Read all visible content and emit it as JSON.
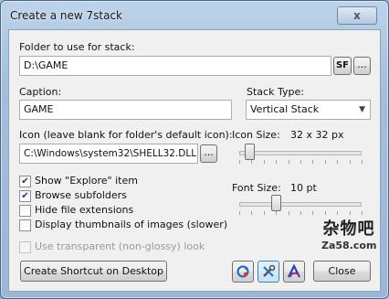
{
  "window": {
    "title": "Create a new 7stack",
    "close_glyph": "x"
  },
  "folder": {
    "label": "Folder to use for stack:",
    "value": "D:\\GAME",
    "sf_button": "SF",
    "browse_button": "..."
  },
  "caption": {
    "label": "Caption:",
    "value": "GAME"
  },
  "stack_type": {
    "label": "Stack Type:",
    "selected": "Vertical Stack"
  },
  "icon": {
    "label": "Icon (leave blank for folder's default icon):",
    "value": "C:\\Windows\\system32\\SHELL32.DLL",
    "browse_button": "..."
  },
  "icon_size": {
    "label": "Icon Size:",
    "value_text": "32 x 32 px",
    "level": 0.08
  },
  "font_size": {
    "label": "Font Size:",
    "value_text": "10 pt",
    "level": 0.3
  },
  "options": [
    {
      "label": "Show \"Explore\" item",
      "checked": true,
      "enabled": true
    },
    {
      "label": "Browse subfolders",
      "checked": true,
      "enabled": true
    },
    {
      "label": "Hide file extensions",
      "checked": false,
      "enabled": true
    },
    {
      "label": "Display thumbnails of images (slower)",
      "checked": false,
      "enabled": true
    },
    {
      "label": "Use transparent (non-glossy) look",
      "checked": false,
      "enabled": false
    }
  ],
  "check_glyph": "✔",
  "buttons": {
    "create_shortcut": "Create Shortcut on Desktop",
    "close": "Close"
  },
  "icons": [
    "refresh-icon",
    "settings-icon",
    "about-icon"
  ],
  "watermark": {
    "cn": "杂物吧",
    "en": "Za58.com"
  }
}
